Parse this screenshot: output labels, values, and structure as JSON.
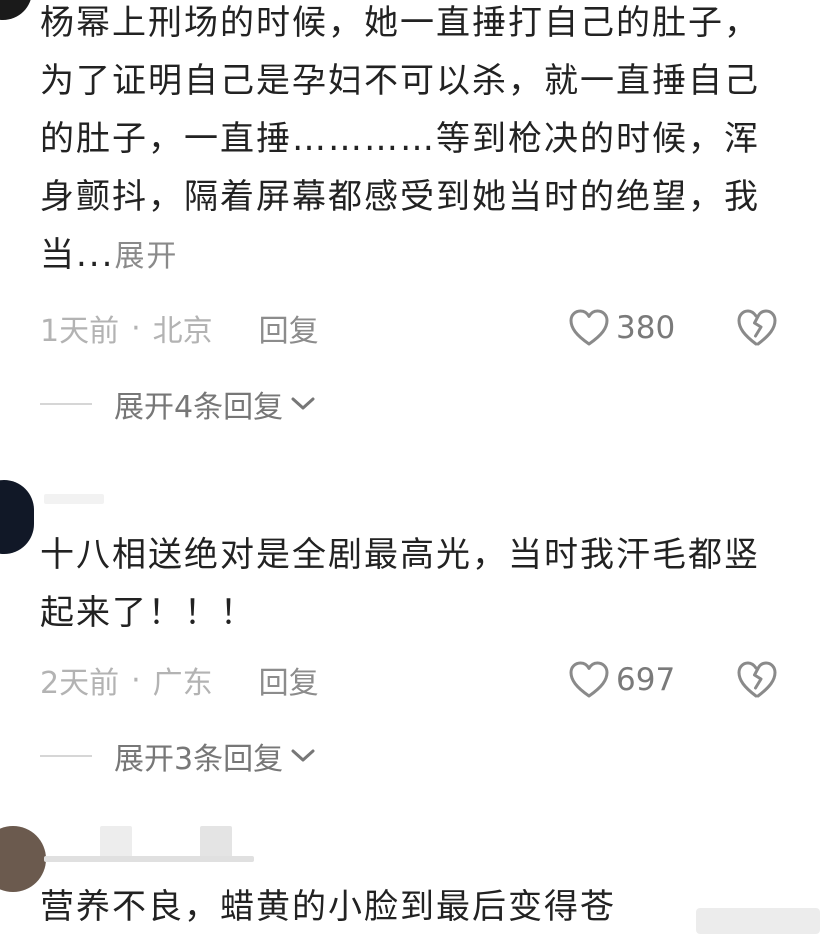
{
  "colors": {
    "text_main": "#222222",
    "text_meta": "#b3b3b3",
    "text_reply": "#8c8c8c",
    "icon_gray": "#8a8a8a"
  },
  "comments": [
    {
      "text": "杨幂上刑场的时候，她一直捶打自己的肚子，为了证明自己是孕妇不可以杀，就一直捶自己的肚子，一直捶…………等到枪决的时候，浑身颤抖，隔着屏幕都感受到她当时的绝望，我当...",
      "expand_label": "展开",
      "time": "1天前",
      "location": "北京",
      "reply_label": "回复",
      "likes": "380",
      "replies_label": "展开4条回复",
      "icons": [
        "heart-outline-icon",
        "broken-heart-icon",
        "chevron-down-icon"
      ]
    },
    {
      "text": "十八相送绝对是全剧最高光，当时我汗毛都竖起来了！！！",
      "time": "2天前",
      "location": "广东",
      "reply_label": "回复",
      "likes": "697",
      "replies_label": "展开3条回复",
      "icons": [
        "heart-outline-icon",
        "broken-heart-icon",
        "chevron-down-icon"
      ]
    },
    {
      "text": "营养不良，蜡黄的小脸到最后变得苍"
    }
  ]
}
